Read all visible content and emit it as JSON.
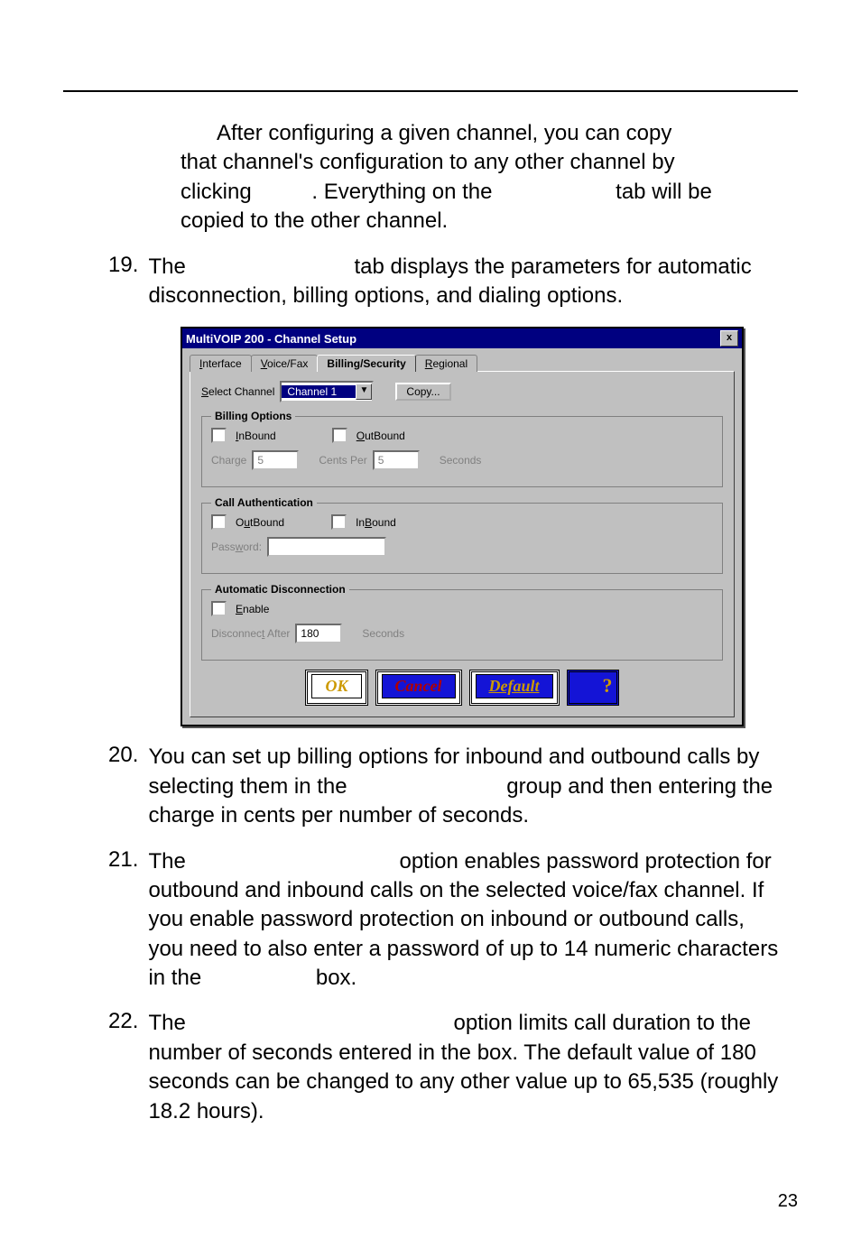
{
  "page_number": "23",
  "note": {
    "line1": "After configuring a given channel, you can copy",
    "line2": "that channel's configuration to any other channel by",
    "line3a": "clicking ",
    "line3b": ".  Everything on the ",
    "line3c": " tab will be",
    "line4": "copied to the other channel."
  },
  "items": {
    "i19": {
      "num": "19.",
      "a": "The ",
      "b": " tab displays the parameters for automatic disconnection, billing options, and dialing options."
    },
    "i20": {
      "num": "20.",
      "a": "You can set up billing options for inbound and outbound calls by selecting them in the ",
      "b": " group and then entering the charge in cents per number of seconds."
    },
    "i21": {
      "num": "21.",
      "a": "The ",
      "b": " option enables password protection for outbound and inbound calls on the selected voice/fax channel.  If you enable password protection on inbound or outbound calls, you need to also enter a password of up to 14 numeric characters in the ",
      "c": " box."
    },
    "i22": {
      "num": "22.",
      "a": "The ",
      "b": " option limits call duration to the number of seconds entered in the ",
      "c": " box.  The default value of 180 seconds can be changed to any other value up to 65,535 (roughly 18.2 hours)."
    }
  },
  "dialog": {
    "title": "MultiVOIP 200 - Channel Setup",
    "close": "x",
    "tabs": {
      "interface": "Interface",
      "voicefax": "Voice/Fax",
      "billing": "Billing/Security",
      "regional": "Regional"
    },
    "select_channel_label": "Select Channel",
    "select_channel_value": "Channel 1",
    "copy_btn": "Copy...",
    "billing_legend": "Billing Options",
    "inbound": "InBound",
    "outbound": "OutBound",
    "charge": "Charge",
    "charge_val": "5",
    "cents_per": "Cents Per",
    "cents_val": "5",
    "seconds": "Seconds",
    "callauth_legend": "Call Authentication",
    "ca_outbound": "OutBound",
    "ca_inbound": "InBound",
    "password": "Password:",
    "autodisc_legend": "Automatic Disconnection",
    "enable": "Enable",
    "disc_after": "Disconnect After",
    "disc_val": "180",
    "disc_seconds": "Seconds",
    "ok": "OK",
    "cancel": "Cancel",
    "default": "Default",
    "help": "?"
  }
}
